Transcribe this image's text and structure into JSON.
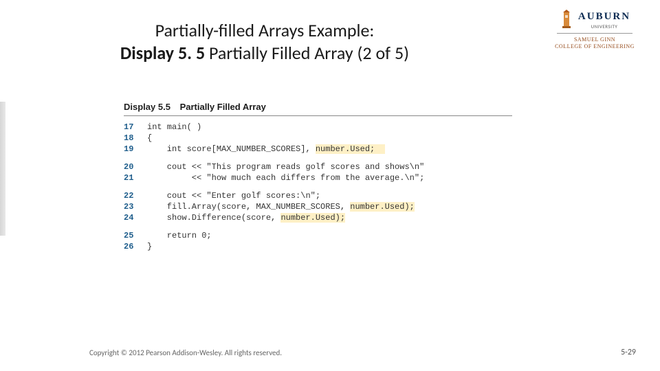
{
  "title": {
    "line1": "Partially-filled Arrays Example:",
    "line2_bold": "Display 5. 5",
    "line2_rest": "  Partially Filled Array (2 of 5)"
  },
  "logo": {
    "university": "AUBURN",
    "uni_sub": "UNIVERSITY",
    "person": "SAMUEL GINN",
    "college": "COLLEGE OF ENGINEERING"
  },
  "display_header": {
    "label": "Display 5.5",
    "title": "Partially Filled Array"
  },
  "code": {
    "l17_no": "17",
    "l17": "int main( )",
    "l18_no": "18",
    "l18": "{",
    "l19_no": "19",
    "l19a": "    int score[MAX_NUMBER_SCORES], ",
    "l19b": "number.Used;",
    "l19c": "  ",
    "l20_no": "20",
    "l20": "    cout << \"This program reads golf scores and shows\\n\"",
    "l21_no": "21",
    "l21": "         << \"how much each differs from the average.\\n\";",
    "l22_no": "22",
    "l22": "    cout << \"Enter golf scores:\\n\";",
    "l23_no": "23",
    "l23a": "    fill.Array(score, MAX_NUMBER_SCORES, ",
    "l23b": "number.Used);",
    "l24_no": "24",
    "l24a": "    show.Difference(score, ",
    "l24b": "number.Used);",
    "l25_no": "25",
    "l25": "    return 0;",
    "l26_no": "26",
    "l26": "}"
  },
  "footer": {
    "copyright": "Copyright © 2012 Pearson Addison-Wesley. All rights reserved.",
    "pagenum": "5-29"
  }
}
